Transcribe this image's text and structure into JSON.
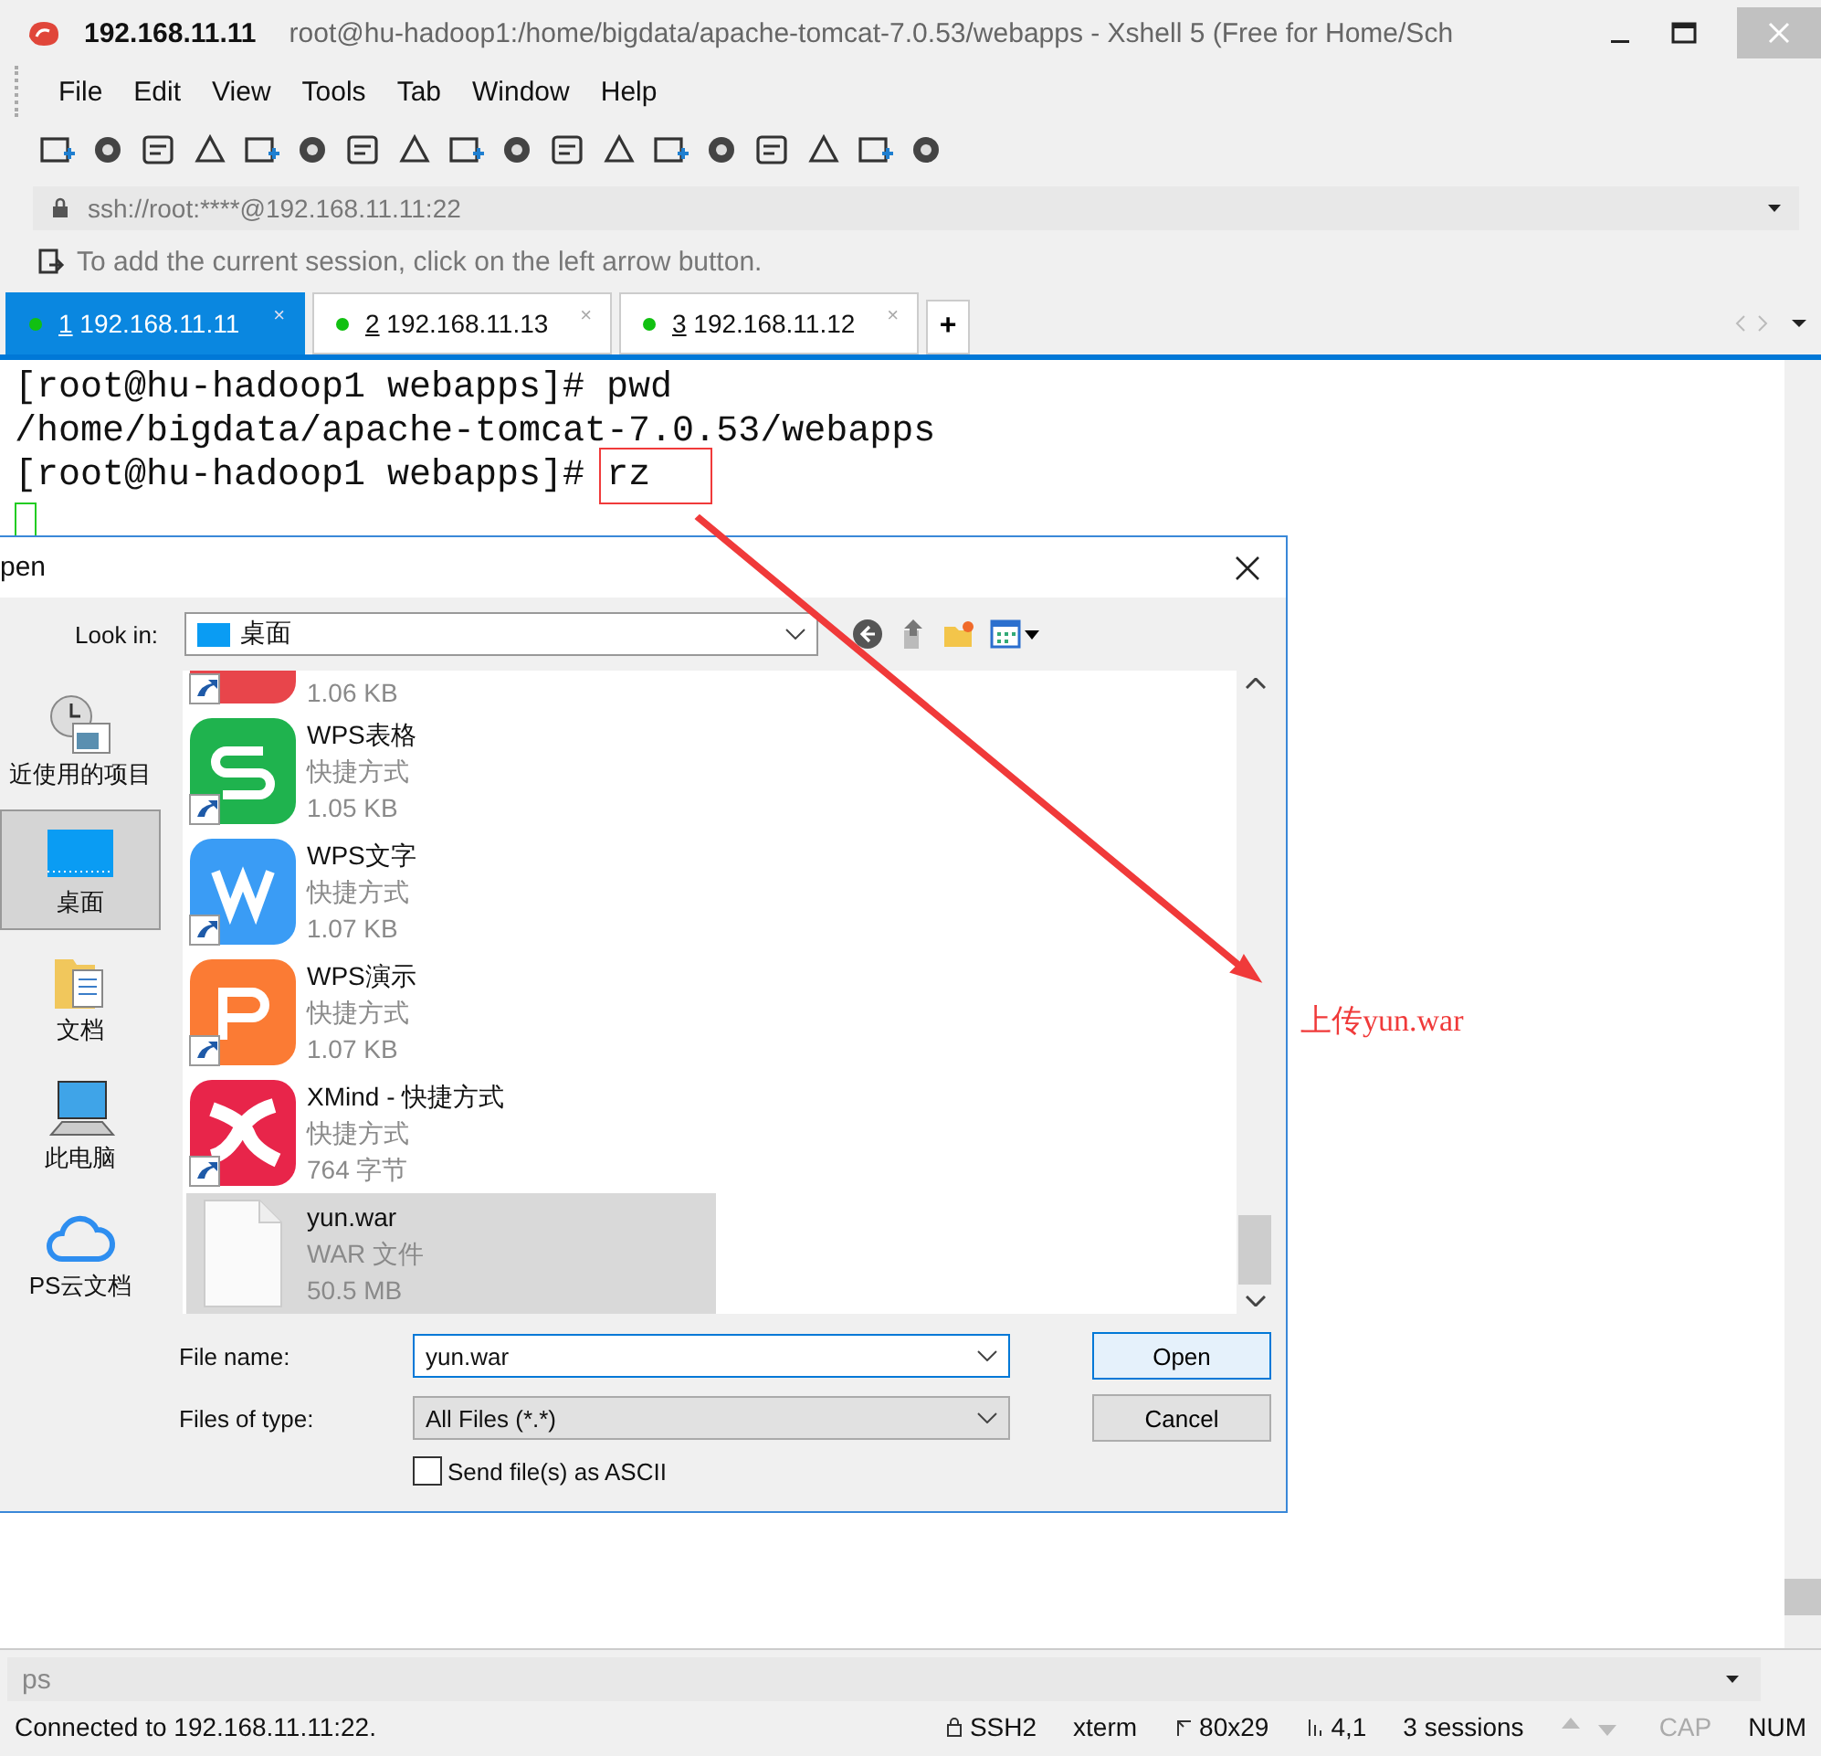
{
  "window": {
    "host": "192.168.11.11",
    "title": "root@hu-hadoop1:/home/bigdata/apache-tomcat-7.0.53/webapps - Xshell 5 (Free for Home/Sch"
  },
  "menu": [
    "File",
    "Edit",
    "View",
    "Tools",
    "Tab",
    "Window",
    "Help"
  ],
  "address": {
    "value": "ssh://root:****@192.168.11.11:22"
  },
  "info_bar": "To add the current session, click on the left arrow button.",
  "tabs": [
    {
      "number": "1",
      "label": "192.168.11.11",
      "close": "×",
      "selected": true
    },
    {
      "number": "2",
      "label": "192.168.11.13",
      "close": "×",
      "selected": false
    },
    {
      "number": "3",
      "label": "192.168.11.12",
      "close": "×",
      "selected": false
    }
  ],
  "new_tab": "+",
  "terminal": {
    "lines": [
      {
        "text": "[root@hu-hadoop1 webapps]# pwd"
      },
      {
        "text": "/home/bigdata/apache-tomcat-7.0.53/webapps"
      },
      {
        "text": "[root@hu-hadoop1 webapps]# ",
        "highlight": "rz"
      }
    ]
  },
  "dialog": {
    "title": "pen",
    "look_in_label": "Look in:",
    "look_in": "桌面",
    "places": [
      {
        "label": "近使用的项目",
        "kind": "recent",
        "selected": false
      },
      {
        "label": "桌面",
        "kind": "desktop",
        "selected": true
      },
      {
        "label": "文档",
        "kind": "documents",
        "selected": false
      },
      {
        "label": "此电脑",
        "kind": "computer",
        "selected": false
      },
      {
        "label": "PS云文档",
        "kind": "cloud",
        "selected": false
      }
    ],
    "files": [
      {
        "kind": "partial",
        "size": "1.06 KB",
        "selected": false
      },
      {
        "kind": "sheet",
        "name": "WPS表格",
        "type": "快捷方式",
        "size": "1.05 KB",
        "selected": false
      },
      {
        "kind": "writer",
        "name": "WPS文字",
        "type": "快捷方式",
        "size": "1.07 KB",
        "selected": false
      },
      {
        "kind": "slides",
        "name": "WPS演示",
        "type": "快捷方式",
        "size": "1.07 KB",
        "selected": false
      },
      {
        "kind": "xmind",
        "name": "XMind - 快捷方式",
        "type": "快捷方式",
        "size": "764 字节",
        "selected": false
      },
      {
        "kind": "file",
        "name": "yun.war",
        "type": "WAR 文件",
        "size": "50.5 MB",
        "selected": true
      }
    ],
    "file_name_label": "File name:",
    "file_name": "yun.war",
    "file_type_label": "Files of type:",
    "file_type": "All Files (*.*)",
    "ascii": {
      "label": "Send file(s) as ASCII",
      "checked": false
    },
    "open": "Open",
    "cancel": "Cancel"
  },
  "annotation": "上传yun.war",
  "compose": {
    "value": "ps"
  },
  "status": {
    "message": "Connected to 192.168.11.11:22.",
    "items": [
      {
        "kind": "protocol",
        "label": "SSH2"
      },
      {
        "kind": "plain",
        "label": "xterm"
      },
      {
        "kind": "size",
        "label": "80x29"
      },
      {
        "kind": "cursor",
        "label": "4,1"
      },
      {
        "kind": "plain",
        "label": "3 sessions"
      }
    ],
    "locks": [
      {
        "label": "CAP",
        "on": false
      },
      {
        "label": "NUM",
        "on": true
      }
    ]
  }
}
